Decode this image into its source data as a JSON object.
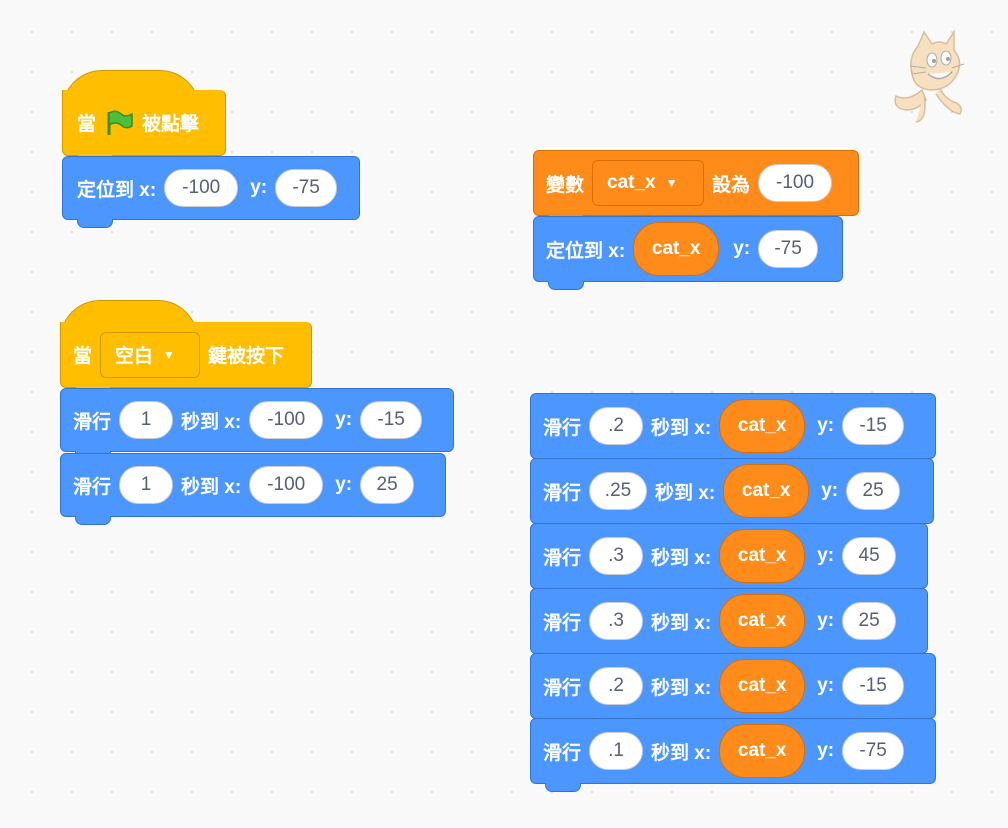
{
  "script1": {
    "hat": {
      "when": "當",
      "flag_icon": "green-flag-icon",
      "clicked": "被點擊"
    },
    "goto": {
      "label": "定位到 x:",
      "x": "-100",
      "ylabel": "y:",
      "y": "-75"
    }
  },
  "script2": {
    "hat": {
      "when": "當",
      "key": "空白",
      "pressed": "鍵被按下"
    },
    "glides": [
      {
        "label": "滑行",
        "secs": "1",
        "to": "秒到 x:",
        "x": "-100",
        "ylabel": "y:",
        "y": "-15"
      },
      {
        "label": "滑行",
        "secs": "1",
        "to": "秒到 x:",
        "x": "-100",
        "ylabel": "y:",
        "y": "25"
      }
    ]
  },
  "script3": {
    "setvar": {
      "label": "變數",
      "var": "cat_x",
      "setto": "設為",
      "value": "-100"
    },
    "goto": {
      "label": "定位到 x:",
      "x": "cat_x",
      "ylabel": "y:",
      "y": "-75"
    }
  },
  "script4": {
    "glides": [
      {
        "label": "滑行",
        "secs": ".2",
        "to": "秒到 x:",
        "x": "cat_x",
        "ylabel": "y:",
        "y": "-15"
      },
      {
        "label": "滑行",
        "secs": ".25",
        "to": "秒到 x:",
        "x": "cat_x",
        "ylabel": "y:",
        "y": "25"
      },
      {
        "label": "滑行",
        "secs": ".3",
        "to": "秒到 x:",
        "x": "cat_x",
        "ylabel": "y:",
        "y": "45"
      },
      {
        "label": "滑行",
        "secs": ".3",
        "to": "秒到 x:",
        "x": "cat_x",
        "ylabel": "y:",
        "y": "25"
      },
      {
        "label": "滑行",
        "secs": ".2",
        "to": "秒到 x:",
        "x": "cat_x",
        "ylabel": "y:",
        "y": "-15"
      },
      {
        "label": "滑行",
        "secs": ".1",
        "to": "秒到 x:",
        "x": "cat_x",
        "ylabel": "y:",
        "y": "-75"
      }
    ]
  },
  "colors": {
    "motion": "#4C97FF",
    "events": "#FFBF00",
    "variables": "#FF8C1A"
  },
  "sprite_icon": "scratch-cat-icon"
}
